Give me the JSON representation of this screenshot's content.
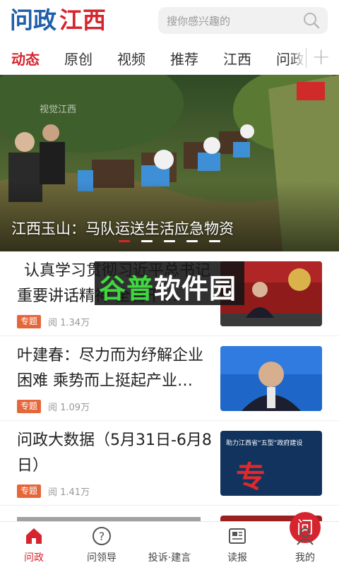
{
  "app": {
    "logo_text": "问政江西",
    "brand_color": "#d6252f",
    "tag_color": "#e4673b"
  },
  "search": {
    "placeholder": "搜你感兴趣的",
    "icon": "search-icon"
  },
  "tabs": [
    {
      "label": "动态",
      "active": true
    },
    {
      "label": "原创",
      "active": false
    },
    {
      "label": "视频",
      "active": false
    },
    {
      "label": "推荐",
      "active": false
    },
    {
      "label": "江西",
      "active": false
    },
    {
      "label": "问政",
      "active": false
    }
  ],
  "tabs_add": "+",
  "banner": {
    "caption": "江西玉山：马队运送生活应急物资",
    "watermark": "视觉江西",
    "slide_count": 5,
    "active_slide": 1
  },
  "articles": [
    {
      "title": "认真学习贯彻习近平总书记重要讲话精神 全省干…",
      "tag": "专题",
      "reads": "阅 1.34万"
    },
    {
      "title": "叶建春：尽力而为纾解企业困难 乘势而上挺起产业…",
      "tag": "专题",
      "reads": "阅 1.09万"
    },
    {
      "title": "问政大数据（5月31日-6月8日）",
      "tag": "专题",
      "reads": "阅 1.41万",
      "thumb_text": "专刊",
      "thumb_subtext": "助力江西省“五型”政府建设"
    }
  ],
  "overlay_ad": {
    "text": "谷普软件园"
  },
  "bottom_nav": [
    {
      "label": "问政",
      "icon": "home-icon",
      "active": true
    },
    {
      "label": "问领导",
      "icon": "question-icon",
      "active": false
    },
    {
      "label": "投诉·建言",
      "icon": "compose-icon",
      "active": false,
      "center_glyph": "问"
    },
    {
      "label": "读报",
      "icon": "newspaper-icon",
      "active": false
    },
    {
      "label": "我的",
      "icon": "user-icon",
      "active": false
    }
  ]
}
